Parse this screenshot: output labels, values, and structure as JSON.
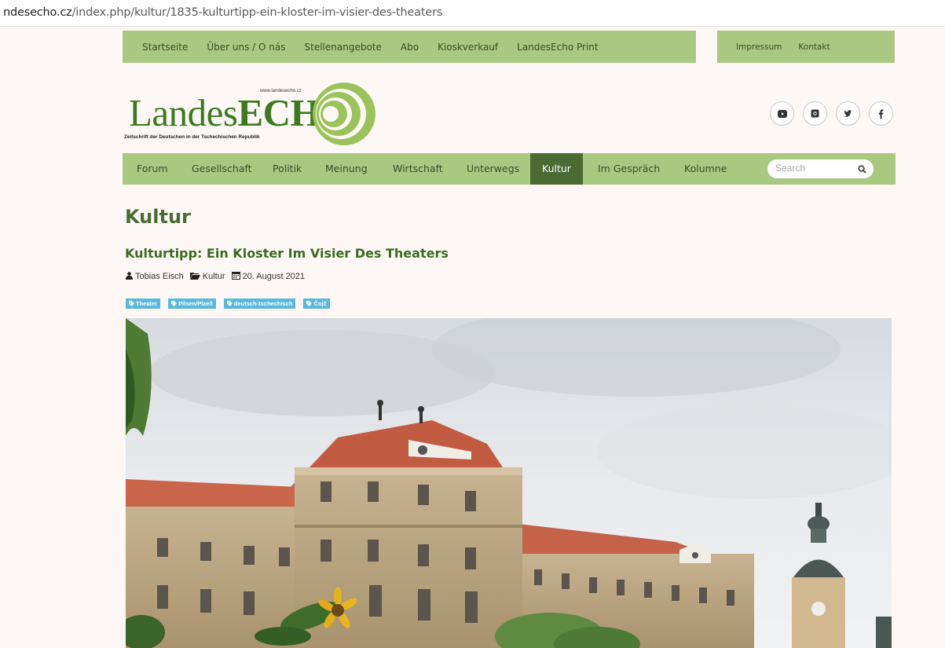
{
  "browser": {
    "url_host_prefix": "ndesecho.cz",
    "url_path": "/index.php/kultur/1835-kulturtipp-ein-kloster-im-visier-des-theaters"
  },
  "top_nav": {
    "items": [
      "Startseite",
      "Über uns / O nás",
      "Stellenangebote",
      "Abo",
      "Kioskverkauf",
      "LandesEcho Print"
    ],
    "secondary": [
      "Impressum",
      "Kontakt"
    ]
  },
  "logo": {
    "word_light": "Landes",
    "word_bold": "ECHO",
    "website": "www.landesecho.cz",
    "tagline": "Zeitschrift der Deutschen in der Tschechischen Republik"
  },
  "social": [
    "youtube-icon",
    "instagram-icon",
    "twitter-icon",
    "facebook-icon"
  ],
  "main_nav": {
    "items": [
      "Forum",
      "Gesellschaft",
      "Politik",
      "Meinung",
      "Wirtschaft",
      "Unterwegs",
      "Kultur",
      "Im Gespräch",
      "Kolumne"
    ],
    "active": "Kultur",
    "search_placeholder": "Search"
  },
  "page": {
    "category": "Kultur",
    "article_title": "Kulturtipp: Ein Kloster Im Visier Des Theaters",
    "author": "Tobias Eisch",
    "section": "Kultur",
    "date": "20. August 2021",
    "tags": [
      "Theater",
      "Pilsen/Plzeň",
      "deutsch-tschechisch",
      "Čojč"
    ]
  },
  "colors": {
    "nav_green": "#a9c982",
    "active_green": "#4b6b32",
    "title_green": "#3b6b22",
    "tag_blue": "#5bb8dc"
  }
}
